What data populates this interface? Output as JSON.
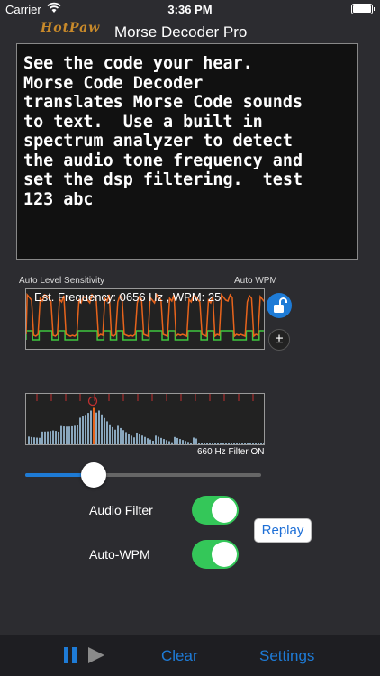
{
  "status": {
    "carrier": "Carrier",
    "time": "3:36 PM"
  },
  "app": {
    "logo_text": "HotPaw",
    "title": "Morse Decoder Pro"
  },
  "decoded_text": "See the code your hear.\nMorse Code Decoder\ntranslates Morse Code sounds\nto text.  Use a built in\nspectrum analyzer to detect\nthe audio tone frequency and\nset the dsp filtering.  test\n123 abc",
  "scope": {
    "level_label": "Auto Level Sensitivity",
    "wpm_label": "Auto WPM",
    "estimate": "Est. Frequency: 0656 Hz ,  WPM: 25"
  },
  "buttons": {
    "plus_minus": "±",
    "replay": "Replay",
    "clear": "Clear",
    "settings": "Settings"
  },
  "spectrum": {
    "filter_label": "660 Hz Filter ON"
  },
  "slider": {
    "value": 0.29
  },
  "controls": {
    "audio_filter": {
      "label": "Audio Filter",
      "on": true
    },
    "auto_wpm": {
      "label": "Auto-WPM",
      "on": true
    }
  },
  "colors": {
    "accent": "#1e7bd6",
    "toggle_on": "#34c759",
    "scope_orange": "#e8641c",
    "scope_green": "#3ec63e",
    "spectrum_bar": "#8aa7bd",
    "spectrum_peak": "#e8641c",
    "marker_red": "#c03030"
  },
  "icons": {
    "wifi": "wifi-icon",
    "battery": "battery-icon",
    "lock": "unlock-icon",
    "pause": "pause-icon",
    "play": "play-icon"
  }
}
